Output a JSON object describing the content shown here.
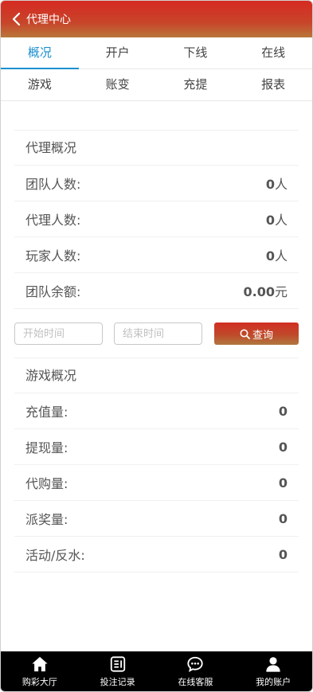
{
  "header": {
    "title": "代理中心"
  },
  "tabs_row1": [
    {
      "label": "概况",
      "active": true
    },
    {
      "label": "开户",
      "active": false
    },
    {
      "label": "下线",
      "active": false
    },
    {
      "label": "在线",
      "active": false
    }
  ],
  "tabs_row2": [
    {
      "label": "游戏"
    },
    {
      "label": "账变"
    },
    {
      "label": "充提"
    },
    {
      "label": "报表"
    }
  ],
  "agent_overview": {
    "title": "代理概况",
    "rows": [
      {
        "label": "团队人数:",
        "value": "0",
        "unit": "人"
      },
      {
        "label": "代理人数:",
        "value": "0",
        "unit": "人"
      },
      {
        "label": "玩家人数:",
        "value": "0",
        "unit": "人"
      },
      {
        "label": "团队余额:",
        "value": "0.00",
        "unit": "元"
      }
    ]
  },
  "query": {
    "start_placeholder": "开始时间",
    "end_placeholder": "结束时间",
    "button_label": "查询"
  },
  "game_overview": {
    "title": "游戏概况",
    "rows": [
      {
        "label": "充值量:",
        "value": "0"
      },
      {
        "label": "提现量:",
        "value": "0"
      },
      {
        "label": "代购量:",
        "value": "0"
      },
      {
        "label": "派奖量:",
        "value": "0"
      },
      {
        "label": "活动/反水:",
        "value": "0"
      }
    ]
  },
  "bottom_nav": [
    {
      "label": "购彩大厅",
      "icon": "home-icon"
    },
    {
      "label": "投注记录",
      "icon": "record-icon"
    },
    {
      "label": "在线客服",
      "icon": "chat-icon"
    },
    {
      "label": "我的账户",
      "icon": "user-icon"
    }
  ]
}
